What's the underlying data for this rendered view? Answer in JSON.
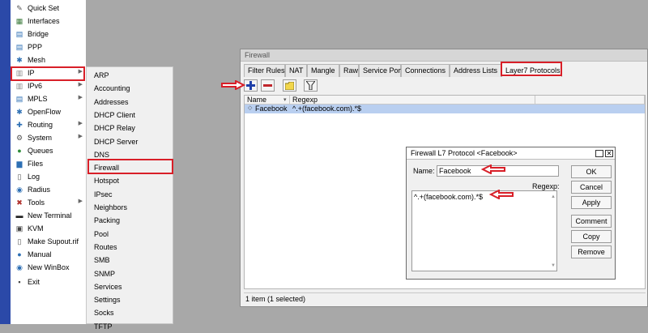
{
  "left_menu": {
    "items": [
      {
        "label": "Quick Set",
        "icon": "quick-set-icon",
        "glyph": "✎",
        "color": "#555555",
        "arrow": false
      },
      {
        "label": "Interfaces",
        "icon": "interfaces-icon",
        "glyph": "▦",
        "color": "#3a7a3a",
        "arrow": false
      },
      {
        "label": "Bridge",
        "icon": "bridge-icon",
        "glyph": "▤",
        "color": "#2d6fb4",
        "arrow": false
      },
      {
        "label": "PPP",
        "icon": "ppp-icon",
        "glyph": "▤",
        "color": "#2d6fb4",
        "arrow": false
      },
      {
        "label": "Mesh",
        "icon": "mesh-icon",
        "glyph": "✱",
        "color": "#2d6fb4",
        "arrow": false
      },
      {
        "label": "IP",
        "icon": "ip-icon",
        "glyph": "▥",
        "color": "#888888",
        "arrow": true
      },
      {
        "label": "IPv6",
        "icon": "ipv6-icon",
        "glyph": "▥",
        "color": "#888888",
        "arrow": true
      },
      {
        "label": "MPLS",
        "icon": "mpls-icon",
        "glyph": "▤",
        "color": "#2d6fb4",
        "arrow": true
      },
      {
        "label": "OpenFlow",
        "icon": "openflow-icon",
        "glyph": "✱",
        "color": "#2d6fb4",
        "arrow": false
      },
      {
        "label": "Routing",
        "icon": "routing-icon",
        "glyph": "✚",
        "color": "#2d6fb4",
        "arrow": true
      },
      {
        "label": "System",
        "icon": "system-icon",
        "glyph": "⚙",
        "color": "#555555",
        "arrow": true
      },
      {
        "label": "Queues",
        "icon": "queues-icon",
        "glyph": "●",
        "color": "#2f8c3a",
        "arrow": false
      },
      {
        "label": "Files",
        "icon": "files-icon",
        "glyph": "▆",
        "color": "#2d6fb4",
        "arrow": false
      },
      {
        "label": "Log",
        "icon": "log-icon",
        "glyph": "▯",
        "color": "#555555",
        "arrow": false
      },
      {
        "label": "Radius",
        "icon": "radius-icon",
        "glyph": "◉",
        "color": "#2d6fb4",
        "arrow": false
      },
      {
        "label": "Tools",
        "icon": "tools-icon",
        "glyph": "✖",
        "color": "#b0302c",
        "arrow": true
      },
      {
        "label": "New Terminal",
        "icon": "terminal-icon",
        "glyph": "▬",
        "color": "#222222",
        "arrow": false
      },
      {
        "label": "KVM",
        "icon": "kvm-icon",
        "glyph": "▣",
        "color": "#444444",
        "arrow": false
      },
      {
        "label": "Make Supout.rif",
        "icon": "supout-icon",
        "glyph": "▯",
        "color": "#555555",
        "arrow": false
      },
      {
        "label": "Manual",
        "icon": "manual-icon",
        "glyph": "●",
        "color": "#2d6fb4",
        "arrow": false
      },
      {
        "label": "New WinBox",
        "icon": "winbox-icon",
        "glyph": "◉",
        "color": "#2d6fb4",
        "arrow": false
      },
      {
        "label": "Exit",
        "icon": "exit-icon",
        "glyph": "▪",
        "color": "#444444",
        "arrow": false
      }
    ]
  },
  "submenu": {
    "items": [
      "ARP",
      "Accounting",
      "Addresses",
      "DHCP Client",
      "DHCP Relay",
      "DHCP Server",
      "DNS",
      "Firewall",
      "Hotspot",
      "IPsec",
      "Neighbors",
      "Packing",
      "Pool",
      "Routes",
      "SMB",
      "SNMP",
      "Services",
      "Settings",
      "Socks",
      "TFTP"
    ]
  },
  "firewall": {
    "title": "Firewall",
    "tabs": [
      "Filter Rules",
      "NAT",
      "Mangle",
      "Raw",
      "Service Ports",
      "Connections",
      "Address Lists",
      "Layer7 Protocols"
    ],
    "active_tab": "Layer7 Protocols",
    "columns": [
      "Name",
      "Regexp"
    ],
    "rows": [
      {
        "name": "Facebook",
        "regexp": "^.+(facebook.com).*$"
      }
    ],
    "status": "1 item (1 selected)"
  },
  "dialog": {
    "title": "Firewall L7 Protocol <Facebook>",
    "name_label": "Name:",
    "name_value": "Facebook",
    "regexp_label": "Regexp:",
    "regexp_value": "^.+(facebook.com).*$",
    "buttons": [
      "OK",
      "Cancel",
      "Apply",
      "Comment",
      "Copy",
      "Remove"
    ]
  },
  "colors": {
    "highlight": "#d81f28",
    "sidebar": "#2b49a8",
    "selected_row": "#b9cff0"
  }
}
